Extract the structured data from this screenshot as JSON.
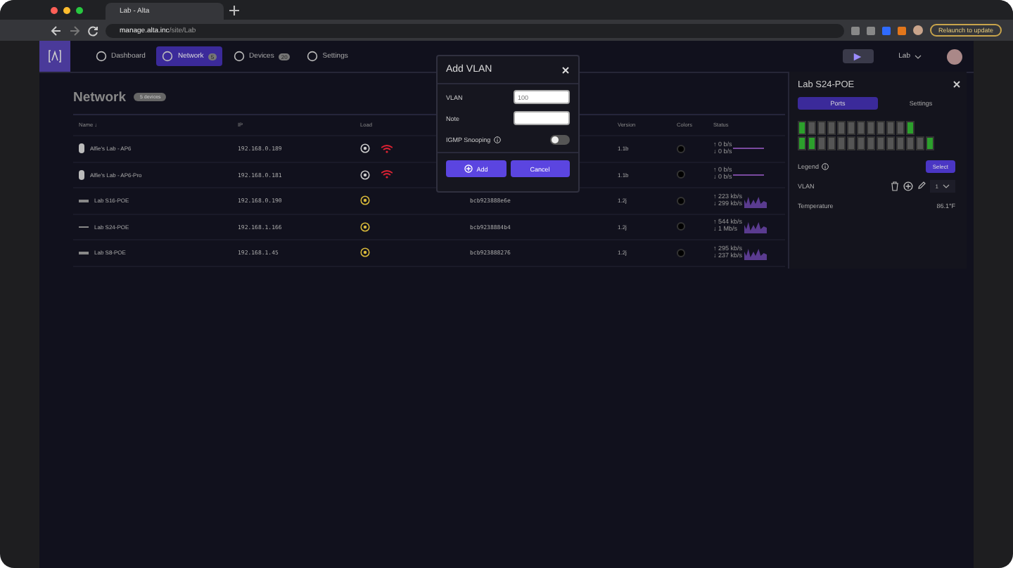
{
  "browser": {
    "tab_title": "Lab - Alta",
    "url_host": "manage.alta.inc",
    "url_path": "/site/Lab",
    "relaunch": "Relaunch to update"
  },
  "nav": {
    "items": [
      {
        "label": "Dashboard",
        "selected": false
      },
      {
        "label": "Network",
        "selected": true,
        "count": "5"
      },
      {
        "label": "Devices",
        "selected": false,
        "count": "20"
      },
      {
        "label": "Settings",
        "selected": false
      }
    ],
    "site": "Lab"
  },
  "page": {
    "title": "Network",
    "badge": "5 devices"
  },
  "table": {
    "columns": [
      "Name ↓",
      "IP",
      "Load",
      "",
      "Version",
      "Colors",
      "Status"
    ],
    "rows": [
      {
        "kind": "ap",
        "name": "Alfie's Lab - AP6",
        "ip": "192.168.0.189",
        "version": "1.1b",
        "status": [
          "↑ 0 b/s",
          "↓ 0 b/s"
        ]
      },
      {
        "kind": "ap",
        "name": "Alfie's Lab - AP6-Pro",
        "ip": "192.168.0.181",
        "version": "1.1b",
        "status": [
          "↑ 0 b/s",
          "↓ 0 b/s"
        ]
      },
      {
        "kind": "switch",
        "name": "Lab S16-POE",
        "ip": "192.168.0.190",
        "mac": "bcb923888e6e",
        "version": "1.2j",
        "status": [
          "↑ 223 kb/s",
          "↓ 299 kb/s"
        ]
      },
      {
        "kind": "switch",
        "name": "Lab S24-POE",
        "ip": "192.168.1.166",
        "mac": "bcb9238884b4",
        "version": "1.2j",
        "status": [
          "↑ 544 kb/s",
          "↓ 1 Mb/s"
        ]
      },
      {
        "kind": "switch",
        "name": "Lab S8-POE",
        "ip": "192.168.1.45",
        "mac": "bcb923888276",
        "version": "1.2j",
        "status": [
          "↑ 295 kb/s",
          "↓ 237 kb/s"
        ]
      }
    ]
  },
  "dialog": {
    "title": "Add VLAN",
    "fields": [
      {
        "label": "VLAN",
        "placeholder": "100"
      },
      {
        "label": "Note"
      }
    ],
    "toggle": {
      "label": "IGMP Snooping",
      "on": false
    },
    "buttons": [
      "Add",
      "Cancel"
    ]
  },
  "panel": {
    "title": "Lab S24-POE",
    "tabs": [
      {
        "label": "Ports",
        "selected": true
      },
      {
        "label": "Settings",
        "selected": false
      }
    ],
    "ports": [
      [
        true,
        false,
        false,
        false,
        false,
        false,
        false,
        false,
        false,
        false,
        false,
        true
      ],
      [
        true,
        true,
        false,
        false,
        false,
        false,
        false,
        false,
        false,
        false,
        false,
        false,
        false,
        true
      ]
    ],
    "legend": "Legend",
    "select": "Select",
    "vlan_label": "VLAN",
    "vlan_value": "1",
    "temperature_label": "Temperature",
    "temperature": "86.1°F"
  }
}
